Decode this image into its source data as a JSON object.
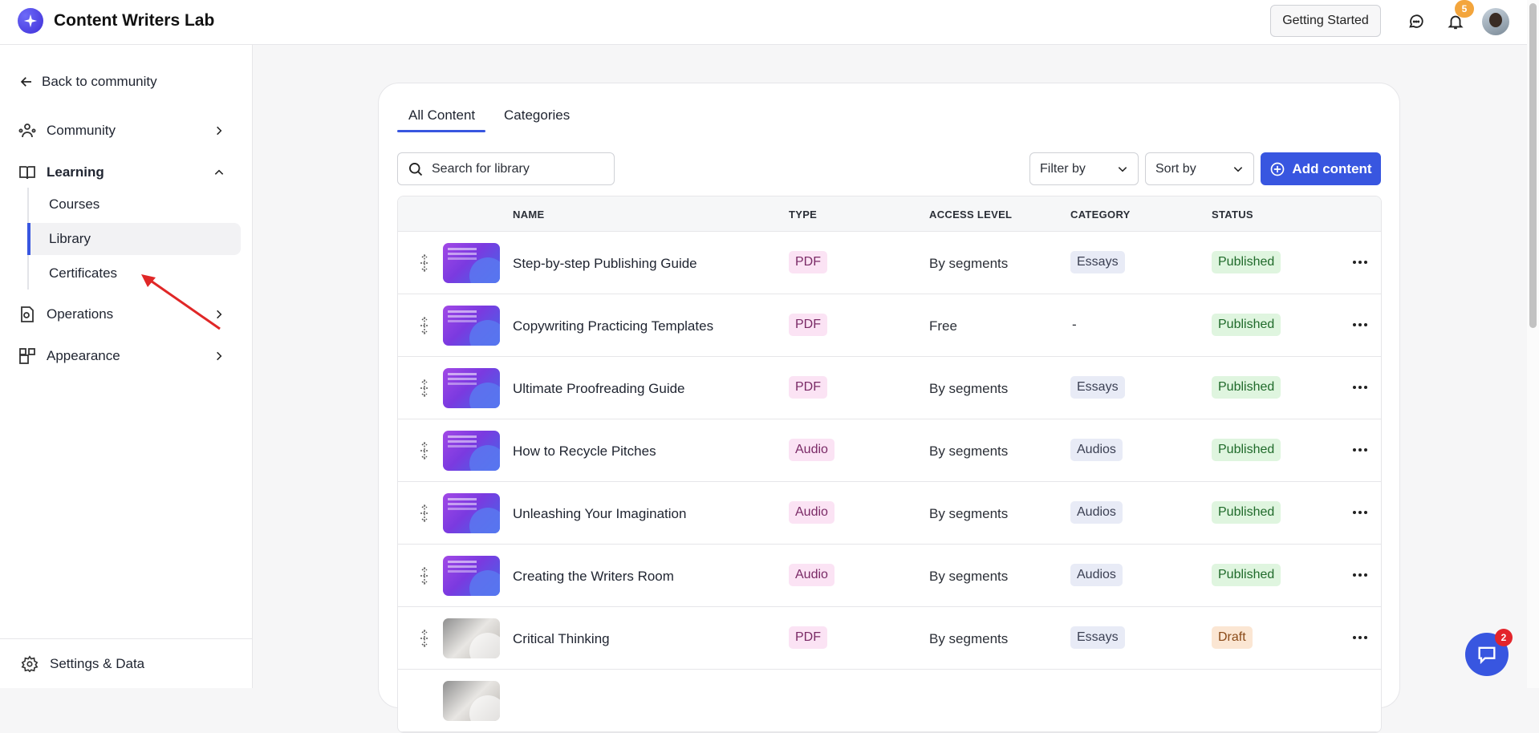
{
  "header": {
    "app_title": "Content Writers Lab",
    "getting_started_label": "Getting Started",
    "notification_count": "5"
  },
  "sidebar": {
    "back_label": "Back to community",
    "items": [
      {
        "label": "Community",
        "icon": "community-icon"
      },
      {
        "label": "Learning",
        "icon": "book-icon"
      },
      {
        "label": "Operations",
        "icon": "operations-icon"
      },
      {
        "label": "Appearance",
        "icon": "appearance-icon"
      }
    ],
    "learning_sub": [
      {
        "label": "Courses"
      },
      {
        "label": "Library"
      },
      {
        "label": "Certificates"
      }
    ],
    "footer_label": "Settings & Data"
  },
  "content": {
    "tabs": [
      {
        "label": "All Content"
      },
      {
        "label": "Categories"
      }
    ],
    "search_placeholder": "Search for library",
    "filter_label": "Filter by",
    "sort_label": "Sort by",
    "add_label": "Add content",
    "columns": {
      "name": "NAME",
      "type": "TYPE",
      "access": "ACCESS LEVEL",
      "category": "CATEGORY",
      "status": "STATUS"
    },
    "rows": [
      {
        "name": "Step-by-step Publishing Guide",
        "type": "PDF",
        "access": "By segments",
        "category": "Essays",
        "status": "Published"
      },
      {
        "name": "Copywriting Practicing Templates",
        "type": "PDF",
        "access": "Free",
        "category": "-",
        "status": "Published"
      },
      {
        "name": "Ultimate Proofreading Guide",
        "type": "PDF",
        "access": "By segments",
        "category": "Essays",
        "status": "Published"
      },
      {
        "name": "How to Recycle Pitches",
        "type": "Audio",
        "access": "By segments",
        "category": "Audios",
        "status": "Published"
      },
      {
        "name": "Unleashing Your Imagination",
        "type": "Audio",
        "access": "By segments",
        "category": "Audios",
        "status": "Published"
      },
      {
        "name": "Creating the Writers Room",
        "type": "Audio",
        "access": "By segments",
        "category": "Audios",
        "status": "Published"
      },
      {
        "name": "Critical Thinking",
        "type": "PDF",
        "access": "By segments",
        "category": "Essays",
        "status": "Draft"
      }
    ]
  },
  "chat": {
    "unread_count": "2"
  },
  "colors": {
    "accent": "#3856e0",
    "annotation_arrow": "#e02727"
  }
}
